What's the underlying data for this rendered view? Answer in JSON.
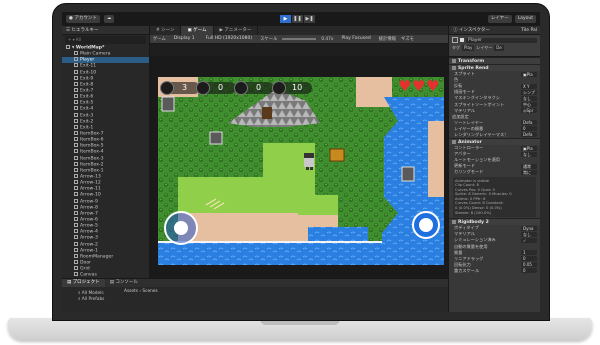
{
  "toolbar": {
    "account": "● アカウント",
    "cloud": "☁",
    "layers": "レイヤー",
    "layout": "Layout"
  },
  "hierarchy": {
    "tab_label": "☰ ヒエラルキー",
    "search_placeholder": "+ ▾  All",
    "scene_name": "WorldMap*",
    "items": [
      "Main Camera",
      "Player",
      "Exit-11",
      "Exit-10",
      "Exit-9",
      "Exit-8",
      "Exit-7",
      "Exit-6",
      "Exit-5",
      "Exit-4",
      "Exit-3",
      "Exit-2",
      "Exit-1",
      "ItemBox-7",
      "ItemBox-6",
      "ItemBox-5",
      "ItemBox-4",
      "ItemBox-3",
      "ItemBox-2",
      "ItemBox-1",
      "Arrow-13",
      "Arrow-12",
      "Arrow-11",
      "Arrow-10",
      "Arrow-9",
      "Arrow-8",
      "Arrow-7",
      "Arrow-6",
      "Arrow-5",
      "Arrow-4",
      "Arrow-3",
      "Arrow-2",
      "Arrow-1",
      "RoomManager",
      "Door",
      "Grid",
      "Canvas",
      "EventSystem"
    ],
    "dontdestroy": "DontDestroyOnLoad"
  },
  "view_tabs": [
    "# シーン",
    "▣ ゲーム",
    "▶ アニメーター"
  ],
  "game_bar": {
    "game_label": "ゲーム",
    "display": "Display 1",
    "resolution": "Full HD (1920x1080)",
    "scale_label": "スケール",
    "scale_value": "0.47x",
    "focus": "Play Focused",
    "stats": "統計情報",
    "gizmos": "ギズモ"
  },
  "hud": {
    "arrows": "3",
    "bombs": "0",
    "keys": "0",
    "coins": "10",
    "hearts": 3
  },
  "bottom": {
    "tabs": [
      "▤ プロジェクト",
      "▤ コンソール"
    ],
    "breadcrumb": "Assets › Scenes",
    "rows": [
      "⌕ All Models",
      "⌕ All Prefabs"
    ]
  },
  "inspector": {
    "tab_label": "ⓘ インスペクター",
    "tile_palette": "Tile Pal",
    "object_name": "Player",
    "tag_label": "タグ",
    "tag_value": "Play",
    "layer_label": "レイヤー",
    "layer_value": "De",
    "transform": "Transform",
    "sprite_renderer": "Sprite Rend",
    "sprite_rows": [
      {
        "label": "スプライト",
        "value": "▣Pla"
      },
      {
        "label": "色",
        "value": ""
      },
      {
        "label": "反転",
        "value": "X Y"
      },
      {
        "label": "描画モード",
        "value": "シンプ"
      },
      {
        "label": "マスキングインタラクシ",
        "value": "なし"
      },
      {
        "label": "スプライトソートポイント",
        "value": "中心"
      },
      {
        "label": "マテリアル",
        "value": "◎Spr"
      }
    ],
    "extra_section": "追加設定",
    "extra_rows": [
      {
        "label": "ソートレイヤー",
        "value": "Defa"
      },
      {
        "label": "レイヤーの順番",
        "value": "0"
      },
      {
        "label": "レンダリングレイヤーマスク",
        "value": "Defa"
      }
    ],
    "animator": "Animator",
    "animator_rows": [
      {
        "label": "コントローラー",
        "value": "▣Pla"
      },
      {
        "label": "アバター",
        "value": "なし"
      },
      {
        "label": "ルートモーションを適用",
        "value": ""
      },
      {
        "label": "更新モード",
        "value": "通常"
      },
      {
        "label": "カリングモード",
        "value": "常に"
      }
    ],
    "animator_info": [
      "Animator is visible",
      "Clip Count: 8",
      "Curves Pos: 0 Quat: 0",
      "Sprite: 8 Generic: 0 Muscles: 0",
      "Animis: 0 PPtr: 8",
      "Curves Count: 8 Constant:",
      "0 (0.0%) Dense: 0 (0.0%)",
      "Stream: 8 (100.0%)"
    ],
    "rigidbody": "Rigidbody 2",
    "rigid_rows": [
      {
        "label": "ボディタイプ",
        "value": "Dyna"
      },
      {
        "label": "マテリアル",
        "value": "なし"
      },
      {
        "label": "シミュレーション済み",
        "value": "✓"
      },
      {
        "label": "自動の質量を使用",
        "value": ""
      },
      {
        "label": "質量",
        "value": "1"
      },
      {
        "label": "リニアドラッグ",
        "value": "0"
      },
      {
        "label": "回転抗力",
        "value": "0.05"
      },
      {
        "label": "重力スケール",
        "value": "0"
      }
    ]
  },
  "colors": {
    "accent": "#2c5d87",
    "play_active": "#2f6fcf",
    "heart": "#e53030",
    "grass": "#3e8c2f",
    "water": "#2b7fe0",
    "sand": "#e8c0a0",
    "rock": "#8c8c8c"
  }
}
